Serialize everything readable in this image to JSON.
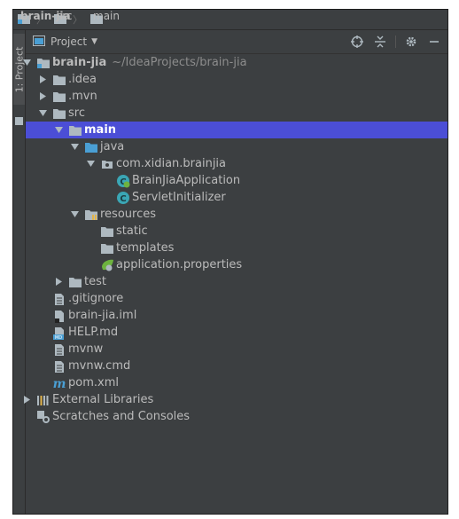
{
  "breadcrumb": [
    {
      "label": "brain-jia",
      "icon": "module-folder-icon"
    },
    {
      "label": "src",
      "icon": "folder-icon"
    },
    {
      "label": "main",
      "icon": "folder-icon"
    }
  ],
  "sidebar": {
    "tab_label": "1: Project"
  },
  "panel": {
    "view_label": "Project"
  },
  "tree": [
    {
      "depth": 0,
      "arrow": "down",
      "icon": "module",
      "label": "brain-jia",
      "hint": "~/IdeaProjects/brain-jia",
      "bold": true
    },
    {
      "depth": 1,
      "arrow": "right",
      "icon": "folder",
      "label": ".idea"
    },
    {
      "depth": 1,
      "arrow": "right",
      "icon": "folder",
      "label": ".mvn"
    },
    {
      "depth": 1,
      "arrow": "down",
      "icon": "folder",
      "label": "src"
    },
    {
      "depth": 2,
      "arrow": "down",
      "icon": "folder-source-root",
      "label": "main",
      "selected": true
    },
    {
      "depth": 3,
      "arrow": "down",
      "icon": "folder-blue",
      "label": "java"
    },
    {
      "depth": 4,
      "arrow": "down",
      "icon": "package",
      "label": "com.xidian.brainjia"
    },
    {
      "depth": 5,
      "arrow": "",
      "icon": "spring-class",
      "label": "BrainJiaApplication"
    },
    {
      "depth": 5,
      "arrow": "",
      "icon": "class",
      "label": "ServletInitializer"
    },
    {
      "depth": 3,
      "arrow": "down",
      "icon": "folder-resources",
      "label": "resources"
    },
    {
      "depth": 4,
      "arrow": "",
      "icon": "folder",
      "label": "static"
    },
    {
      "depth": 4,
      "arrow": "",
      "icon": "folder",
      "label": "templates"
    },
    {
      "depth": 4,
      "arrow": "",
      "icon": "spring-properties",
      "label": "application.properties"
    },
    {
      "depth": 2,
      "arrow": "right",
      "icon": "folder",
      "label": "test"
    },
    {
      "depth": 1,
      "arrow": "",
      "icon": "file-text",
      "label": ".gitignore"
    },
    {
      "depth": 1,
      "arrow": "",
      "icon": "file-iml",
      "label": "brain-jia.iml"
    },
    {
      "depth": 1,
      "arrow": "",
      "icon": "file-markdown",
      "label": "HELP.md"
    },
    {
      "depth": 1,
      "arrow": "",
      "icon": "file-text",
      "label": "mvnw"
    },
    {
      "depth": 1,
      "arrow": "",
      "icon": "file-text",
      "label": "mvnw.cmd"
    },
    {
      "depth": 1,
      "arrow": "",
      "icon": "maven",
      "label": "pom.xml"
    },
    {
      "depth": 0,
      "arrow": "right",
      "icon": "libraries",
      "label": "External Libraries"
    },
    {
      "depth": 0,
      "arrow": "",
      "icon": "scratches",
      "label": "Scratches and Consoles"
    }
  ],
  "colors": {
    "selection": "#4b4ed6",
    "panel": "#3c3f41",
    "text": "#bbbbbb",
    "folder": "#aeb9c0",
    "source_folder": "#4a9fd4"
  }
}
